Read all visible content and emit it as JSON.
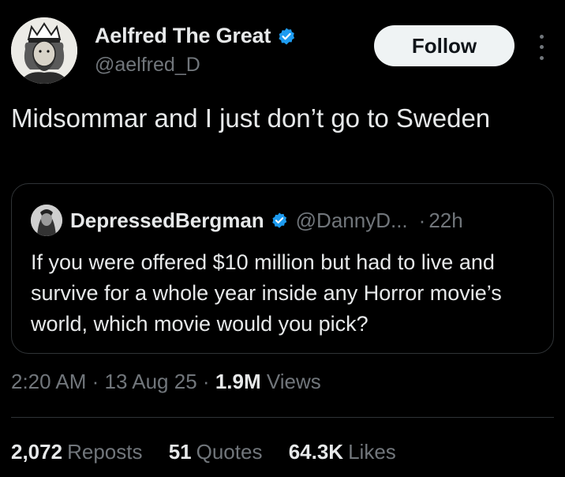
{
  "author": {
    "name": "Aelfred The Great",
    "handle": "@aelfred_D",
    "verified": true,
    "avatar_icon": "king-portrait-icon"
  },
  "follow_label": "Follow",
  "more_icon": "more-vertical-icon",
  "tweet": {
    "text": "Midsommar and I just don’t go to Sweden"
  },
  "quoted": {
    "name": "DepressedBergman",
    "handle": "@DannyD...",
    "separator": "·",
    "time": "22h",
    "text": "If you were offered $10 million but had to live and survive for a whole year inside any Horror movie’s world, which movie would you pick?"
  },
  "meta": {
    "time": "2:20 AM",
    "date": "13 Aug 25",
    "separator": "·",
    "views_count": "1.9M",
    "views_label": "Views"
  },
  "stats": {
    "reposts_count": "2,072",
    "reposts_label": "Reposts",
    "quotes_count": "51",
    "quotes_label": "Quotes",
    "likes_count": "64.3K",
    "likes_label": "Likes"
  },
  "colors": {
    "background": "#000000",
    "text": "#e7e9ea",
    "secondary": "#71767b",
    "verified": "#1d9bf0",
    "border": "#2f3336"
  }
}
